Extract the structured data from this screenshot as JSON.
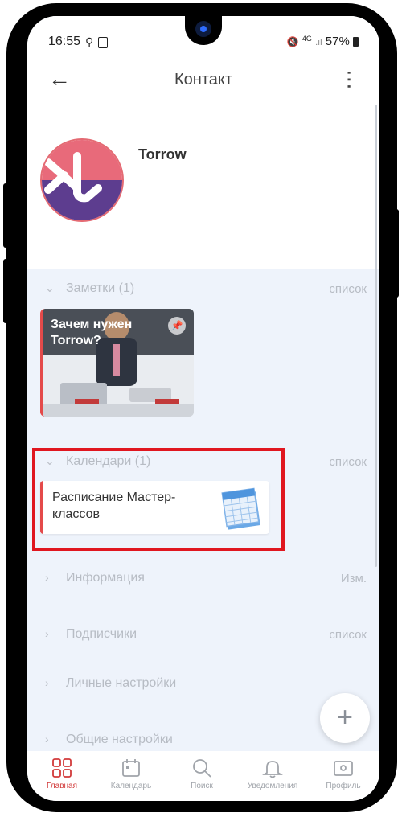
{
  "status_bar": {
    "time": "16:55",
    "battery": "57%",
    "network": "4G"
  },
  "header": {
    "title": "Контакт"
  },
  "profile": {
    "name": "Torrow"
  },
  "sections": [
    {
      "label": "Заметки (1)",
      "action": "список"
    },
    {
      "label": "Календари (1)",
      "action": "список"
    },
    {
      "label": "Информация",
      "action": "Изм."
    },
    {
      "label": "Подписчики",
      "action": "список"
    },
    {
      "label": "Личные настройки",
      "action": ""
    },
    {
      "label": "Общие настройки",
      "action": ""
    }
  ],
  "note_card": {
    "title": "Зачем нужен Torrow?"
  },
  "calendar_card": {
    "title": "Расписание Мастер-классов"
  },
  "fab": {
    "label": "+"
  },
  "bottom_nav": [
    {
      "label": "Главная",
      "icon": "home-grid-icon",
      "active": true
    },
    {
      "label": "Календарь",
      "icon": "calendar-icon",
      "active": false
    },
    {
      "label": "Поиск",
      "icon": "search-icon",
      "active": false
    },
    {
      "label": "Уведомления",
      "icon": "bell-icon",
      "active": false
    },
    {
      "label": "Профиль",
      "icon": "profile-card-icon",
      "active": false
    }
  ],
  "colors": {
    "accent": "#d23a3a",
    "highlight_box": "#e0161f",
    "background": "#eef3fb"
  }
}
